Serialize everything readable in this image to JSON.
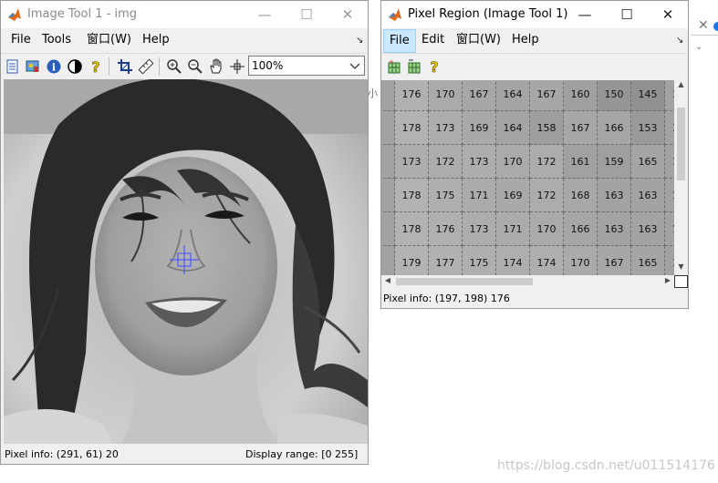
{
  "image_tool": {
    "title": "Image Tool 1 - img",
    "menus": [
      "File",
      "Tools",
      "窗口(W)",
      "Help"
    ],
    "zoom_value": "100%",
    "status": {
      "pixel_info": "Pixel info: (291, 61)  20",
      "display_range": "Display range: [0 255]"
    },
    "toolbar_icons": [
      "new-figure-icon",
      "image-info-icon",
      "info-icon",
      "contrast-icon",
      "help-icon",
      "crop-icon",
      "measure-distance-icon",
      "zoom-in-icon",
      "zoom-out-icon",
      "pan-hand-icon",
      "pixel-region-icon"
    ]
  },
  "pixel_region": {
    "title": "Pixel Region (Image Tool 1)",
    "menus": [
      "File",
      "Edit",
      "窗口(W)",
      "Help"
    ],
    "active_menu": "File",
    "toolbar_icons": [
      "copy-position-icon",
      "pixel-info-icon",
      "help-icon"
    ],
    "status": "Pixel info: (197, 198)  176",
    "left_partial_digits": [
      "2",
      "8",
      "0",
      "1",
      "1",
      "1"
    ],
    "rows": [
      [
        176,
        170,
        167,
        164,
        167,
        160,
        150,
        145
      ],
      [
        178,
        173,
        169,
        164,
        158,
        167,
        166,
        153
      ],
      [
        173,
        172,
        173,
        170,
        172,
        161,
        159,
        165
      ],
      [
        178,
        175,
        171,
        169,
        172,
        168,
        163,
        163
      ],
      [
        178,
        176,
        173,
        171,
        170,
        166,
        163,
        163
      ],
      [
        179,
        177,
        175,
        174,
        174,
        170,
        167,
        165
      ]
    ],
    "right_partial_digits": [
      "1",
      "1",
      "1",
      "1",
      "1",
      "1"
    ]
  },
  "background": {
    "fragment_label": "小",
    "watermark": "https://blog.csdn.net/u011514176"
  }
}
